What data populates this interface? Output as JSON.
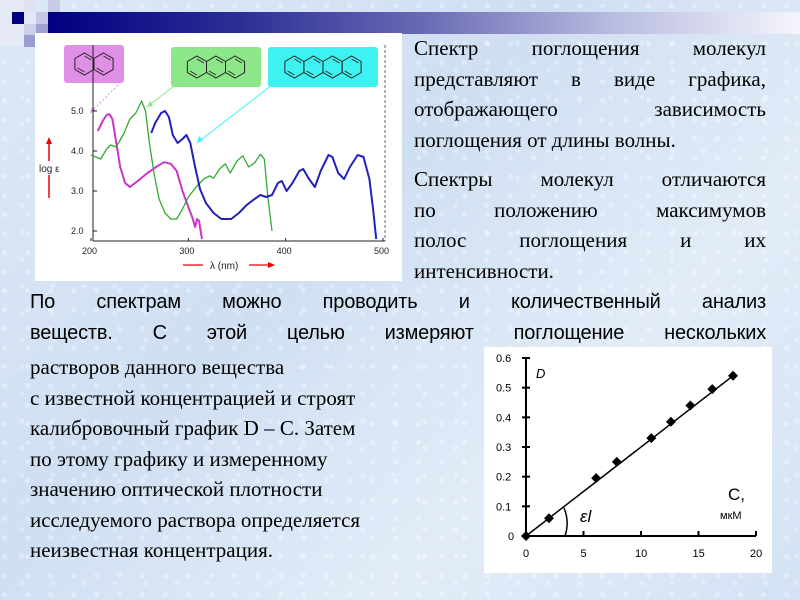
{
  "slide": {
    "accent_colors": {
      "title_bar_start": "#000080",
      "title_bar_end": "#f4f5fb"
    }
  },
  "right_text": {
    "paragraph1": [
      "Спектр поглощения молекул",
      "представляют в виде графика,",
      "отображающего зависимость",
      "поглощения от длины волны."
    ],
    "paragraph2": [
      "Спектры молекул отличаются",
      "по положению максимумов",
      "полос поглощения и их",
      "интенсивности."
    ]
  },
  "wide_text": [
    "По спектрам можно проводить и количественный анализ",
    "веществ. С этой целью измеряют поглощение нескольких"
  ],
  "left_text": [
    "растворов данного вещества",
    "с известной концентрацией и строят",
    "калибровочный график D – C. Затем",
    "по этому графику и измеренному",
    "значению оптической плотности",
    "исследуемого раствора определяется",
    "неизвестная концентрация."
  ],
  "chart_data": [
    {
      "type": "line",
      "title": "",
      "xlabel": "λ (nm)",
      "ylabel": "log ε",
      "xlim": [
        200,
        500
      ],
      "ylim": [
        1.8,
        5.6
      ],
      "x_ticks": [
        "200",
        "300",
        "400",
        "500"
      ],
      "y_ticks": [
        "2.0",
        "3.0",
        "4.0",
        "5.0"
      ],
      "grid": false,
      "legend": "molecule structure images at top with arrows to curves",
      "molecules": [
        {
          "name": "naphthalene",
          "rings": 2,
          "color": "#e08fe6"
        },
        {
          "name": "anthracene",
          "rings": 3,
          "color": "#8ee68a"
        },
        {
          "name": "tetracene",
          "rings": 4,
          "color": "#3ff2f2"
        }
      ],
      "series": [
        {
          "name": "naphthalene",
          "color": "#cc33cc",
          "points": [
            [
              207,
              4.5
            ],
            [
              212,
              4.75
            ],
            [
              216,
              4.9
            ],
            [
              219,
              4.92
            ],
            [
              222,
              4.8
            ],
            [
              226,
              4.2
            ],
            [
              230,
              3.6
            ],
            [
              235,
              3.2
            ],
            [
              240,
              3.1
            ],
            [
              248,
              3.25
            ],
            [
              258,
              3.45
            ],
            [
              268,
              3.62
            ],
            [
              275,
              3.72
            ],
            [
              282,
              3.68
            ],
            [
              288,
              3.5
            ],
            [
              294,
              3.0
            ],
            [
              300,
              2.6
            ],
            [
              304,
              2.35
            ],
            [
              307,
              2.1
            ],
            [
              309,
              2.3
            ],
            [
              311,
              2.25
            ],
            [
              314,
              1.8
            ]
          ]
        },
        {
          "name": "anthracene",
          "color": "#33aa33",
          "points": [
            [
              200,
              3.9
            ],
            [
              205,
              3.85
            ],
            [
              210,
              3.8
            ],
            [
              216,
              4.05
            ],
            [
              220,
              4.15
            ],
            [
              226,
              4.1
            ],
            [
              234,
              4.45
            ],
            [
              240,
              4.8
            ],
            [
              246,
              4.95
            ],
            [
              250,
              5.15
            ],
            [
              252,
              5.25
            ],
            [
              256,
              5.0
            ],
            [
              260,
              4.2
            ],
            [
              265,
              3.4
            ],
            [
              270,
              2.8
            ],
            [
              276,
              2.45
            ],
            [
              282,
              2.3
            ],
            [
              288,
              2.3
            ],
            [
              294,
              2.55
            ],
            [
              300,
              2.85
            ],
            [
              308,
              3.1
            ],
            [
              316,
              3.3
            ],
            [
              322,
              3.38
            ],
            [
              326,
              3.32
            ],
            [
              332,
              3.55
            ],
            [
              338,
              3.68
            ],
            [
              343,
              3.45
            ],
            [
              350,
              3.75
            ],
            [
              356,
              3.88
            ],
            [
              362,
              3.6
            ],
            [
              368,
              3.7
            ],
            [
              374,
              3.92
            ],
            [
              378,
              3.8
            ],
            [
              382,
              2.8
            ],
            [
              386,
              2.0
            ]
          ]
        },
        {
          "name": "tetracene",
          "color": "#2222bb",
          "points": [
            [
              262,
              4.45
            ],
            [
              266,
              4.7
            ],
            [
              272,
              4.95
            ],
            [
              276,
              5.0
            ],
            [
              280,
              4.85
            ],
            [
              284,
              4.4
            ],
            [
              289,
              4.2
            ],
            [
              294,
              4.3
            ],
            [
              298,
              4.4
            ],
            [
              302,
              4.2
            ],
            [
              307,
              3.6
            ],
            [
              312,
              3.05
            ],
            [
              318,
              2.7
            ],
            [
              326,
              2.45
            ],
            [
              334,
              2.3
            ],
            [
              344,
              2.3
            ],
            [
              352,
              2.45
            ],
            [
              360,
              2.65
            ],
            [
              368,
              2.8
            ],
            [
              374,
              2.9
            ],
            [
              380,
              2.85
            ],
            [
              386,
              2.9
            ],
            [
              392,
              3.2
            ],
            [
              396,
              3.25
            ],
            [
              401,
              3.0
            ],
            [
              407,
              3.2
            ],
            [
              414,
              3.5
            ],
            [
              418,
              3.55
            ],
            [
              424,
              3.3
            ],
            [
              430,
              3.1
            ],
            [
              436,
              3.5
            ],
            [
              444,
              3.9
            ],
            [
              448,
              3.85
            ],
            [
              454,
              3.45
            ],
            [
              460,
              3.3
            ],
            [
              466,
              3.6
            ],
            [
              474,
              3.9
            ],
            [
              480,
              3.85
            ],
            [
              486,
              3.3
            ],
            [
              490,
              2.5
            ],
            [
              493,
              1.8
            ]
          ]
        }
      ]
    },
    {
      "type": "scatter",
      "title": "",
      "xlabel": "C, мкМ",
      "xlabel_main": "C,",
      "xlabel_unit": "мкМ",
      "ylabel": "D",
      "xlim": [
        0,
        20
      ],
      "ylim": [
        0,
        0.6
      ],
      "x_ticks": [
        "0",
        "5",
        "10",
        "15",
        "20"
      ],
      "y_ticks": [
        "0",
        "0.1",
        "0.2",
        "0.3",
        "0.4",
        "0.5",
        "0.6"
      ],
      "grid": false,
      "angle_label": "εl",
      "fit_line": {
        "x": [
          0,
          18
        ],
        "y": [
          0,
          0.54
        ]
      },
      "series": [
        {
          "name": "calibration",
          "x": [
            0,
            2,
            6.1,
            7.9,
            10.9,
            12.6,
            14.3,
            16.2,
            18
          ],
          "y": [
            0,
            0.06,
            0.195,
            0.25,
            0.33,
            0.385,
            0.44,
            0.495,
            0.54
          ]
        }
      ]
    }
  ]
}
